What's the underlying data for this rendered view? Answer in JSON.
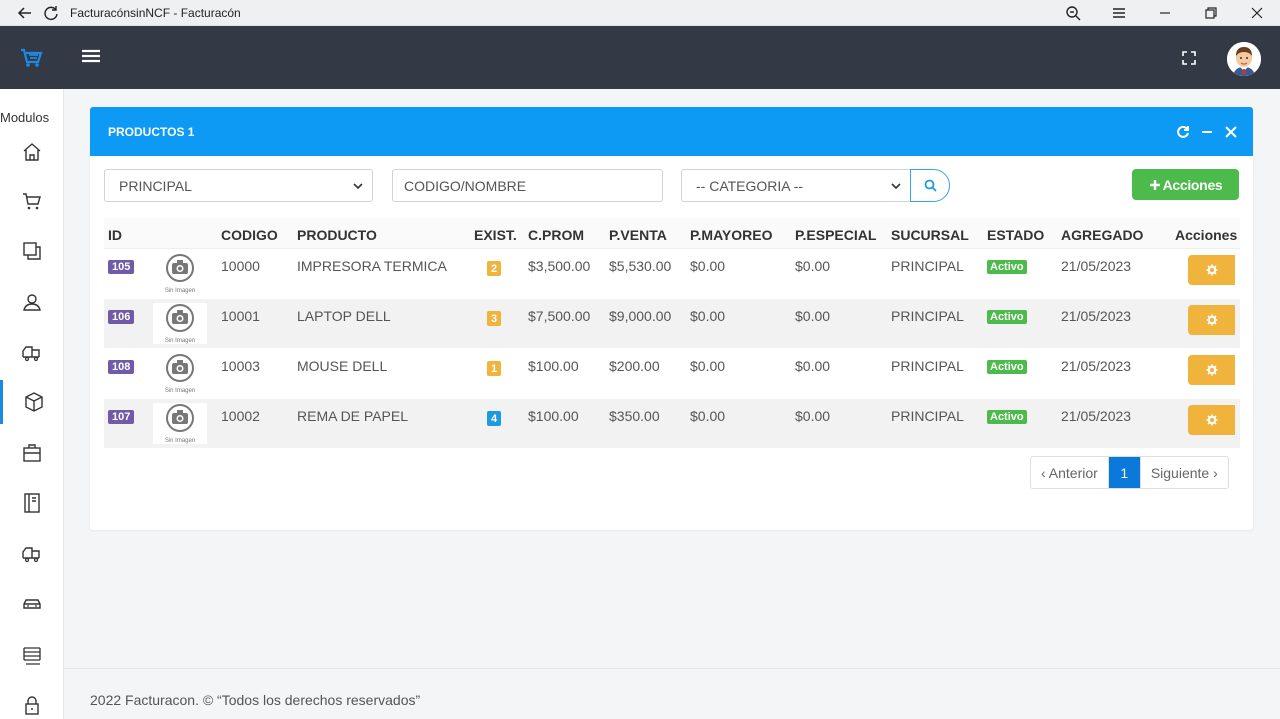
{
  "window": {
    "title": "FacturacónsinNCF - Facturacón"
  },
  "sidebar": {
    "label": "Modulos",
    "items": [
      {
        "icon": "home-icon"
      },
      {
        "icon": "cart-icon"
      },
      {
        "icon": "copy-icon"
      },
      {
        "icon": "user-icon"
      },
      {
        "icon": "truck-icon"
      },
      {
        "icon": "box-icon",
        "active": true
      },
      {
        "icon": "briefcase-icon"
      },
      {
        "icon": "notebook-icon"
      },
      {
        "icon": "truck-icon"
      },
      {
        "icon": "car-icon"
      },
      {
        "icon": "server-icon"
      },
      {
        "icon": "lock-icon"
      }
    ]
  },
  "panel": {
    "title": "PRODUCTOS 1",
    "filters": {
      "sucursal": "PRINCIPAL",
      "search_placeholder": "CODIGO/NOMBRE",
      "categoria": "-- CATEGORIA --",
      "acciones_label": "Acciones"
    },
    "table": {
      "headers": [
        "ID",
        "CODIGO",
        "PRODUCTO",
        "EXIST.",
        "C.PROM",
        "P.VENTA",
        "P.MAYOREO",
        "P.ESPECIAL",
        "SUCURSAL",
        "ESTADO",
        "AGREGADO",
        "Acciones"
      ],
      "image_caption": "Sin Imagen",
      "rows": [
        {
          "id": "105",
          "codigo": "10000",
          "producto": "IMPRESORA TERMICA",
          "exist": "2",
          "exist_color": "#f0b33c",
          "cprom": "$3,500.00",
          "pventa": "$5,530.00",
          "pmayoreo": "$0.00",
          "pespecial": "$0.00",
          "sucursal": "PRINCIPAL",
          "estado": "Activo",
          "agregado": "21/05/2023"
        },
        {
          "id": "106",
          "codigo": "10001",
          "producto": "LAPTOP DELL",
          "exist": "3",
          "exist_color": "#f0b33c",
          "cprom": "$7,500.00",
          "pventa": "$9,000.00",
          "pmayoreo": "$0.00",
          "pespecial": "$0.00",
          "sucursal": "PRINCIPAL",
          "estado": "Activo",
          "agregado": "21/05/2023"
        },
        {
          "id": "108",
          "codigo": "10003",
          "producto": "MOUSE DELL",
          "exist": "1",
          "exist_color": "#f0b33c",
          "cprom": "$100.00",
          "pventa": "$200.00",
          "pmayoreo": "$0.00",
          "pespecial": "$0.00",
          "sucursal": "PRINCIPAL",
          "estado": "Activo",
          "agregado": "21/05/2023"
        },
        {
          "id": "107",
          "codigo": "10002",
          "producto": "REMA DE PAPEL",
          "exist": "4",
          "exist_color": "#1e9be0",
          "cprom": "$100.00",
          "pventa": "$350.00",
          "pmayoreo": "$0.00",
          "pespecial": "$0.00",
          "sucursal": "PRINCIPAL",
          "estado": "Activo",
          "agregado": "21/05/2023"
        }
      ]
    },
    "pagination": {
      "prev": "‹ Anterior",
      "current": "1",
      "next": "Siguiente ›"
    }
  },
  "footer": {
    "text": "2022 Facturacon. © “Todos los derechos reservados”"
  },
  "colors": {
    "header_bg": "#343a45",
    "panel_head": "#0d9af5",
    "id_badge": "#6f5ba8",
    "success": "#4cbb4c",
    "warning": "#f0b33c",
    "primary": "#0a79d9"
  }
}
